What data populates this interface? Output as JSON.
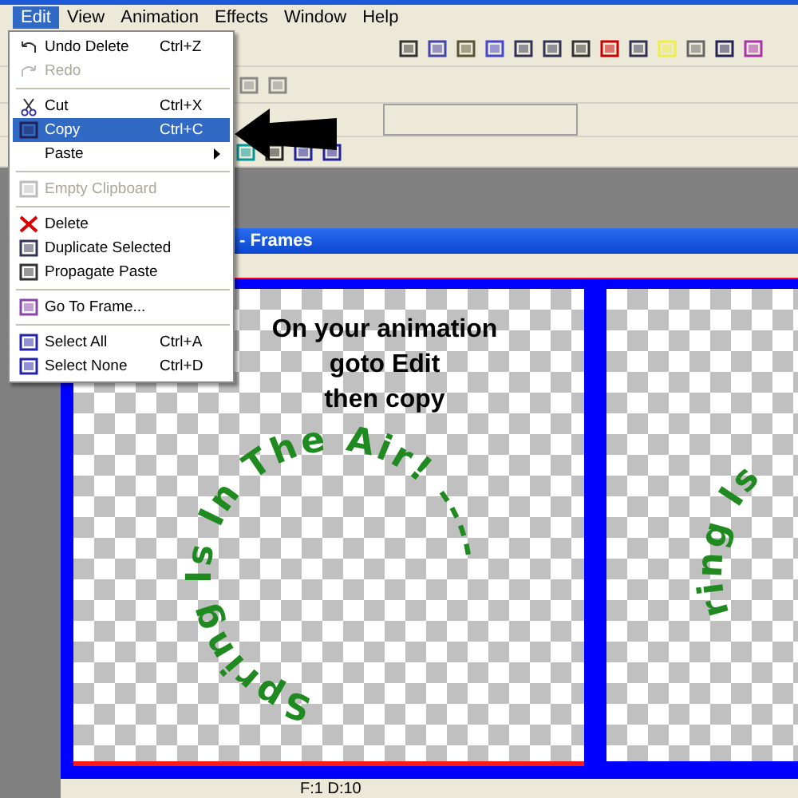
{
  "menu_bar": [
    {
      "label": "Edit",
      "selected": true
    },
    {
      "label": "View",
      "selected": false
    },
    {
      "label": "Animation",
      "selected": false
    },
    {
      "label": "Effects",
      "selected": false
    },
    {
      "label": "Window",
      "selected": false
    },
    {
      "label": "Help",
      "selected": false
    }
  ],
  "edit_menu": [
    {
      "kind": "item",
      "label": "Undo Delete",
      "shortcut": "Ctrl+Z",
      "disabled": false,
      "selected": false,
      "submenu": false
    },
    {
      "kind": "item",
      "label": "Redo",
      "disabled": true,
      "selected": false,
      "submenu": false
    },
    {
      "kind": "separator"
    },
    {
      "kind": "item",
      "label": "Cut",
      "shortcut": "Ctrl+X",
      "disabled": false,
      "selected": false,
      "submenu": false
    },
    {
      "kind": "item",
      "label": "Copy",
      "shortcut": "Ctrl+C",
      "disabled": false,
      "selected": true,
      "submenu": false
    },
    {
      "kind": "item",
      "label": "Paste",
      "disabled": false,
      "selected": false,
      "submenu": true
    },
    {
      "kind": "separator"
    },
    {
      "kind": "item",
      "label": "Empty Clipboard",
      "disabled": true,
      "selected": false,
      "submenu": false
    },
    {
      "kind": "separator"
    },
    {
      "kind": "item",
      "label": "Delete",
      "disabled": false,
      "selected": false,
      "submenu": false
    },
    {
      "kind": "item",
      "label": "Duplicate Selected",
      "disabled": false,
      "selected": false,
      "submenu": false
    },
    {
      "kind": "item",
      "label": "Propagate Paste",
      "disabled": false,
      "selected": false,
      "submenu": false
    },
    {
      "kind": "separator"
    },
    {
      "kind": "item",
      "label": "Go To Frame...",
      "disabled": false,
      "selected": false,
      "submenu": false
    },
    {
      "kind": "separator"
    },
    {
      "kind": "item",
      "label": "Select All",
      "shortcut": "Ctrl+A",
      "disabled": false,
      "selected": false,
      "submenu": false
    },
    {
      "kind": "item",
      "label": "Select None",
      "shortcut": "Ctrl+D",
      "disabled": false,
      "selected": false,
      "submenu": false
    }
  ],
  "frames_window": {
    "title": "- Frames",
    "frames": [
      {
        "selected": true,
        "curved_text": "Spring Is In The Air! ----"
      },
      {
        "selected": false,
        "curved_text": "ring Is"
      }
    ],
    "instruction": [
      "On your animation",
      "goto Edit",
      "then copy"
    ],
    "status": "F:1  D:10"
  }
}
